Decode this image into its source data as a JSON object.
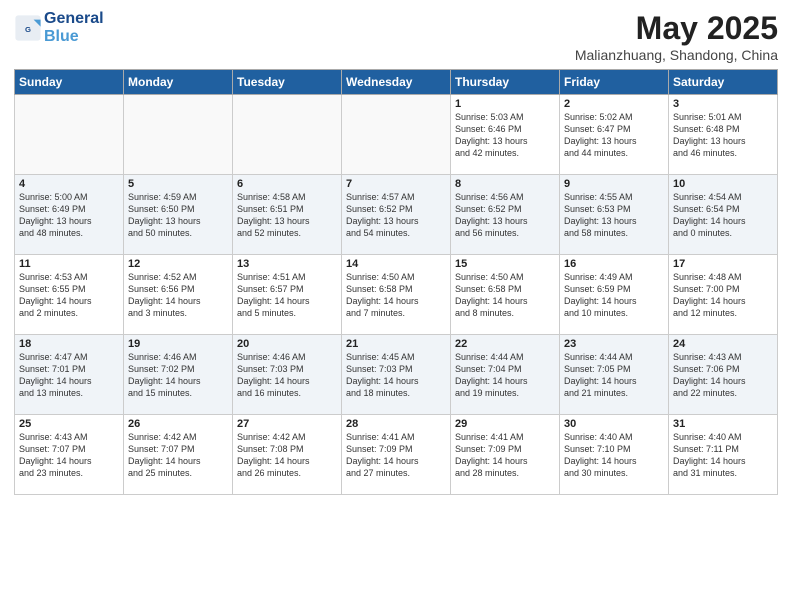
{
  "header": {
    "logo_line1": "General",
    "logo_line2": "Blue",
    "main_title": "May 2025",
    "subtitle": "Malianzhuang, Shandong, China"
  },
  "days_of_week": [
    "Sunday",
    "Monday",
    "Tuesday",
    "Wednesday",
    "Thursday",
    "Friday",
    "Saturday"
  ],
  "weeks": [
    [
      {
        "day": "",
        "info": ""
      },
      {
        "day": "",
        "info": ""
      },
      {
        "day": "",
        "info": ""
      },
      {
        "day": "",
        "info": ""
      },
      {
        "day": "1",
        "info": "Sunrise: 5:03 AM\nSunset: 6:46 PM\nDaylight: 13 hours\nand 42 minutes."
      },
      {
        "day": "2",
        "info": "Sunrise: 5:02 AM\nSunset: 6:47 PM\nDaylight: 13 hours\nand 44 minutes."
      },
      {
        "day": "3",
        "info": "Sunrise: 5:01 AM\nSunset: 6:48 PM\nDaylight: 13 hours\nand 46 minutes."
      }
    ],
    [
      {
        "day": "4",
        "info": "Sunrise: 5:00 AM\nSunset: 6:49 PM\nDaylight: 13 hours\nand 48 minutes."
      },
      {
        "day": "5",
        "info": "Sunrise: 4:59 AM\nSunset: 6:50 PM\nDaylight: 13 hours\nand 50 minutes."
      },
      {
        "day": "6",
        "info": "Sunrise: 4:58 AM\nSunset: 6:51 PM\nDaylight: 13 hours\nand 52 minutes."
      },
      {
        "day": "7",
        "info": "Sunrise: 4:57 AM\nSunset: 6:52 PM\nDaylight: 13 hours\nand 54 minutes."
      },
      {
        "day": "8",
        "info": "Sunrise: 4:56 AM\nSunset: 6:52 PM\nDaylight: 13 hours\nand 56 minutes."
      },
      {
        "day": "9",
        "info": "Sunrise: 4:55 AM\nSunset: 6:53 PM\nDaylight: 13 hours\nand 58 minutes."
      },
      {
        "day": "10",
        "info": "Sunrise: 4:54 AM\nSunset: 6:54 PM\nDaylight: 14 hours\nand 0 minutes."
      }
    ],
    [
      {
        "day": "11",
        "info": "Sunrise: 4:53 AM\nSunset: 6:55 PM\nDaylight: 14 hours\nand 2 minutes."
      },
      {
        "day": "12",
        "info": "Sunrise: 4:52 AM\nSunset: 6:56 PM\nDaylight: 14 hours\nand 3 minutes."
      },
      {
        "day": "13",
        "info": "Sunrise: 4:51 AM\nSunset: 6:57 PM\nDaylight: 14 hours\nand 5 minutes."
      },
      {
        "day": "14",
        "info": "Sunrise: 4:50 AM\nSunset: 6:58 PM\nDaylight: 14 hours\nand 7 minutes."
      },
      {
        "day": "15",
        "info": "Sunrise: 4:50 AM\nSunset: 6:58 PM\nDaylight: 14 hours\nand 8 minutes."
      },
      {
        "day": "16",
        "info": "Sunrise: 4:49 AM\nSunset: 6:59 PM\nDaylight: 14 hours\nand 10 minutes."
      },
      {
        "day": "17",
        "info": "Sunrise: 4:48 AM\nSunset: 7:00 PM\nDaylight: 14 hours\nand 12 minutes."
      }
    ],
    [
      {
        "day": "18",
        "info": "Sunrise: 4:47 AM\nSunset: 7:01 PM\nDaylight: 14 hours\nand 13 minutes."
      },
      {
        "day": "19",
        "info": "Sunrise: 4:46 AM\nSunset: 7:02 PM\nDaylight: 14 hours\nand 15 minutes."
      },
      {
        "day": "20",
        "info": "Sunrise: 4:46 AM\nSunset: 7:03 PM\nDaylight: 14 hours\nand 16 minutes."
      },
      {
        "day": "21",
        "info": "Sunrise: 4:45 AM\nSunset: 7:03 PM\nDaylight: 14 hours\nand 18 minutes."
      },
      {
        "day": "22",
        "info": "Sunrise: 4:44 AM\nSunset: 7:04 PM\nDaylight: 14 hours\nand 19 minutes."
      },
      {
        "day": "23",
        "info": "Sunrise: 4:44 AM\nSunset: 7:05 PM\nDaylight: 14 hours\nand 21 minutes."
      },
      {
        "day": "24",
        "info": "Sunrise: 4:43 AM\nSunset: 7:06 PM\nDaylight: 14 hours\nand 22 minutes."
      }
    ],
    [
      {
        "day": "25",
        "info": "Sunrise: 4:43 AM\nSunset: 7:07 PM\nDaylight: 14 hours\nand 23 minutes."
      },
      {
        "day": "26",
        "info": "Sunrise: 4:42 AM\nSunset: 7:07 PM\nDaylight: 14 hours\nand 25 minutes."
      },
      {
        "day": "27",
        "info": "Sunrise: 4:42 AM\nSunset: 7:08 PM\nDaylight: 14 hours\nand 26 minutes."
      },
      {
        "day": "28",
        "info": "Sunrise: 4:41 AM\nSunset: 7:09 PM\nDaylight: 14 hours\nand 27 minutes."
      },
      {
        "day": "29",
        "info": "Sunrise: 4:41 AM\nSunset: 7:09 PM\nDaylight: 14 hours\nand 28 minutes."
      },
      {
        "day": "30",
        "info": "Sunrise: 4:40 AM\nSunset: 7:10 PM\nDaylight: 14 hours\nand 30 minutes."
      },
      {
        "day": "31",
        "info": "Sunrise: 4:40 AM\nSunset: 7:11 PM\nDaylight: 14 hours\nand 31 minutes."
      }
    ]
  ]
}
